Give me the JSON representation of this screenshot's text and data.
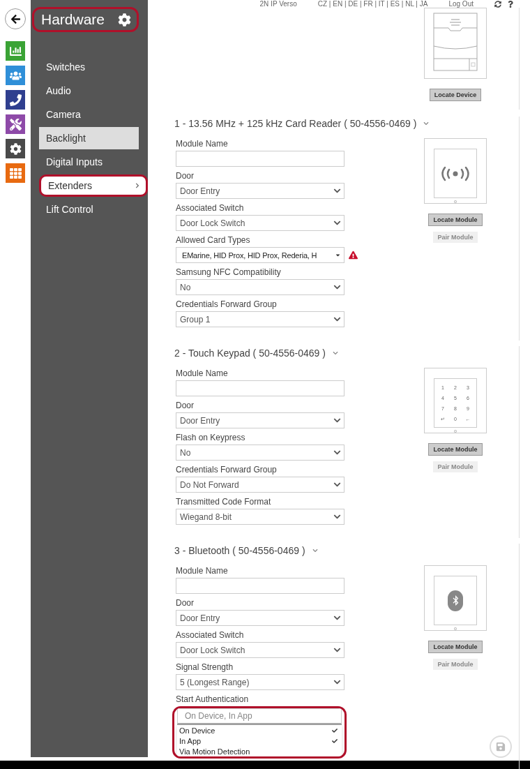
{
  "top_bar": {
    "device": "2N IP Verso",
    "languages": "CZ | EN | DE | FR | IT | ES | NL | JA",
    "logout": "Log Out"
  },
  "nav_icons": [
    {
      "kind": "stats",
      "color": "#3aa335"
    },
    {
      "kind": "users",
      "color": "#2f8fd8"
    },
    {
      "kind": "phone",
      "color": "#2f3f8f"
    },
    {
      "kind": "tools",
      "color": "#8e4aa8"
    },
    {
      "kind": "settings",
      "color": "#4a4a4a"
    },
    {
      "kind": "grid",
      "color": "#e86a10"
    }
  ],
  "sidebar": {
    "title": "Hardware",
    "highlighted": true,
    "items": [
      {
        "label": "Switches",
        "selected": false,
        "hovered": false,
        "highlighted": false
      },
      {
        "label": "Audio",
        "selected": false,
        "hovered": false,
        "highlighted": false
      },
      {
        "label": "Camera",
        "selected": false,
        "hovered": false,
        "highlighted": false
      },
      {
        "label": "Backlight",
        "selected": false,
        "hovered": true,
        "highlighted": false
      },
      {
        "label": "Digital Inputs",
        "selected": false,
        "hovered": false,
        "highlighted": false
      },
      {
        "label": "Extenders",
        "selected": true,
        "hovered": false,
        "highlighted": true
      },
      {
        "label": "Lift Control",
        "selected": false,
        "hovered": false,
        "highlighted": false
      }
    ]
  },
  "sections": [
    {
      "kind": "intercom",
      "buttons": [
        {
          "label": "Locate Device",
          "disabled": false
        }
      ]
    },
    {
      "title": "1 - 13.56 MHz + 125 kHz Card Reader ( 50-4556-0469 )",
      "kind": "card-reader",
      "fields": [
        {
          "label": "Module Name",
          "kind": "text"
        },
        {
          "label": "Door",
          "kind": "select",
          "value": "Door Entry"
        },
        {
          "label": "Associated Switch",
          "kind": "select",
          "value": "Door Lock Switch"
        },
        {
          "label": "Allowed Card Types",
          "kind": "multi",
          "value": "EMarine, HID Prox, HID Prox, Rederia, H",
          "warning": true
        },
        {
          "label": "Samsung NFC Compatibility",
          "kind": "select",
          "value": "No"
        },
        {
          "label": "Credentials Forward Group",
          "kind": "select",
          "value": "Group 1"
        }
      ],
      "buttons": [
        {
          "label": "Locate Module",
          "disabled": false
        },
        {
          "label": "Pair Module",
          "disabled": true
        }
      ]
    },
    {
      "title": "2 - Touch Keypad ( 50-4556-0469 )",
      "kind": "keypad",
      "keys": [
        "1",
        "2",
        "3",
        "4",
        "5",
        "6",
        "7",
        "8",
        "9",
        "↵",
        "0",
        "←"
      ],
      "fields": [
        {
          "label": "Module Name",
          "kind": "text"
        },
        {
          "label": "Door",
          "kind": "select",
          "value": "Door Entry"
        },
        {
          "label": "Flash on Keypress",
          "kind": "select",
          "value": "No"
        },
        {
          "label": "Credentials Forward Group",
          "kind": "select",
          "value": "Do Not Forward"
        },
        {
          "label": "Transmitted Code Format",
          "kind": "select",
          "value": "Wiegand 8-bit"
        }
      ],
      "buttons": [
        {
          "label": "Locate Module",
          "disabled": false
        },
        {
          "label": "Pair Module",
          "disabled": true
        }
      ]
    },
    {
      "title": "3 - Bluetooth ( 50-4556-0469 )",
      "kind": "bluetooth",
      "fields": [
        {
          "label": "Module Name",
          "kind": "text"
        },
        {
          "label": "Door",
          "kind": "select",
          "value": "Door Entry"
        },
        {
          "label": "Associated Switch",
          "kind": "select",
          "value": "Door Lock Switch"
        },
        {
          "label": "Signal Strength",
          "kind": "select",
          "value": "5 (Longest Range)"
        },
        {
          "label": "Start Authentication",
          "kind": "open-multi",
          "value": "On Device, In App",
          "highlighted": true,
          "options": [
            {
              "label": "On Device",
              "checked": true
            },
            {
              "label": "In App",
              "checked": true
            },
            {
              "label": "Via Motion Detection",
              "checked": false
            }
          ]
        }
      ],
      "buttons": [
        {
          "label": "Locate Module",
          "disabled": false
        },
        {
          "label": "Pair Module",
          "disabled": true
        }
      ]
    }
  ]
}
